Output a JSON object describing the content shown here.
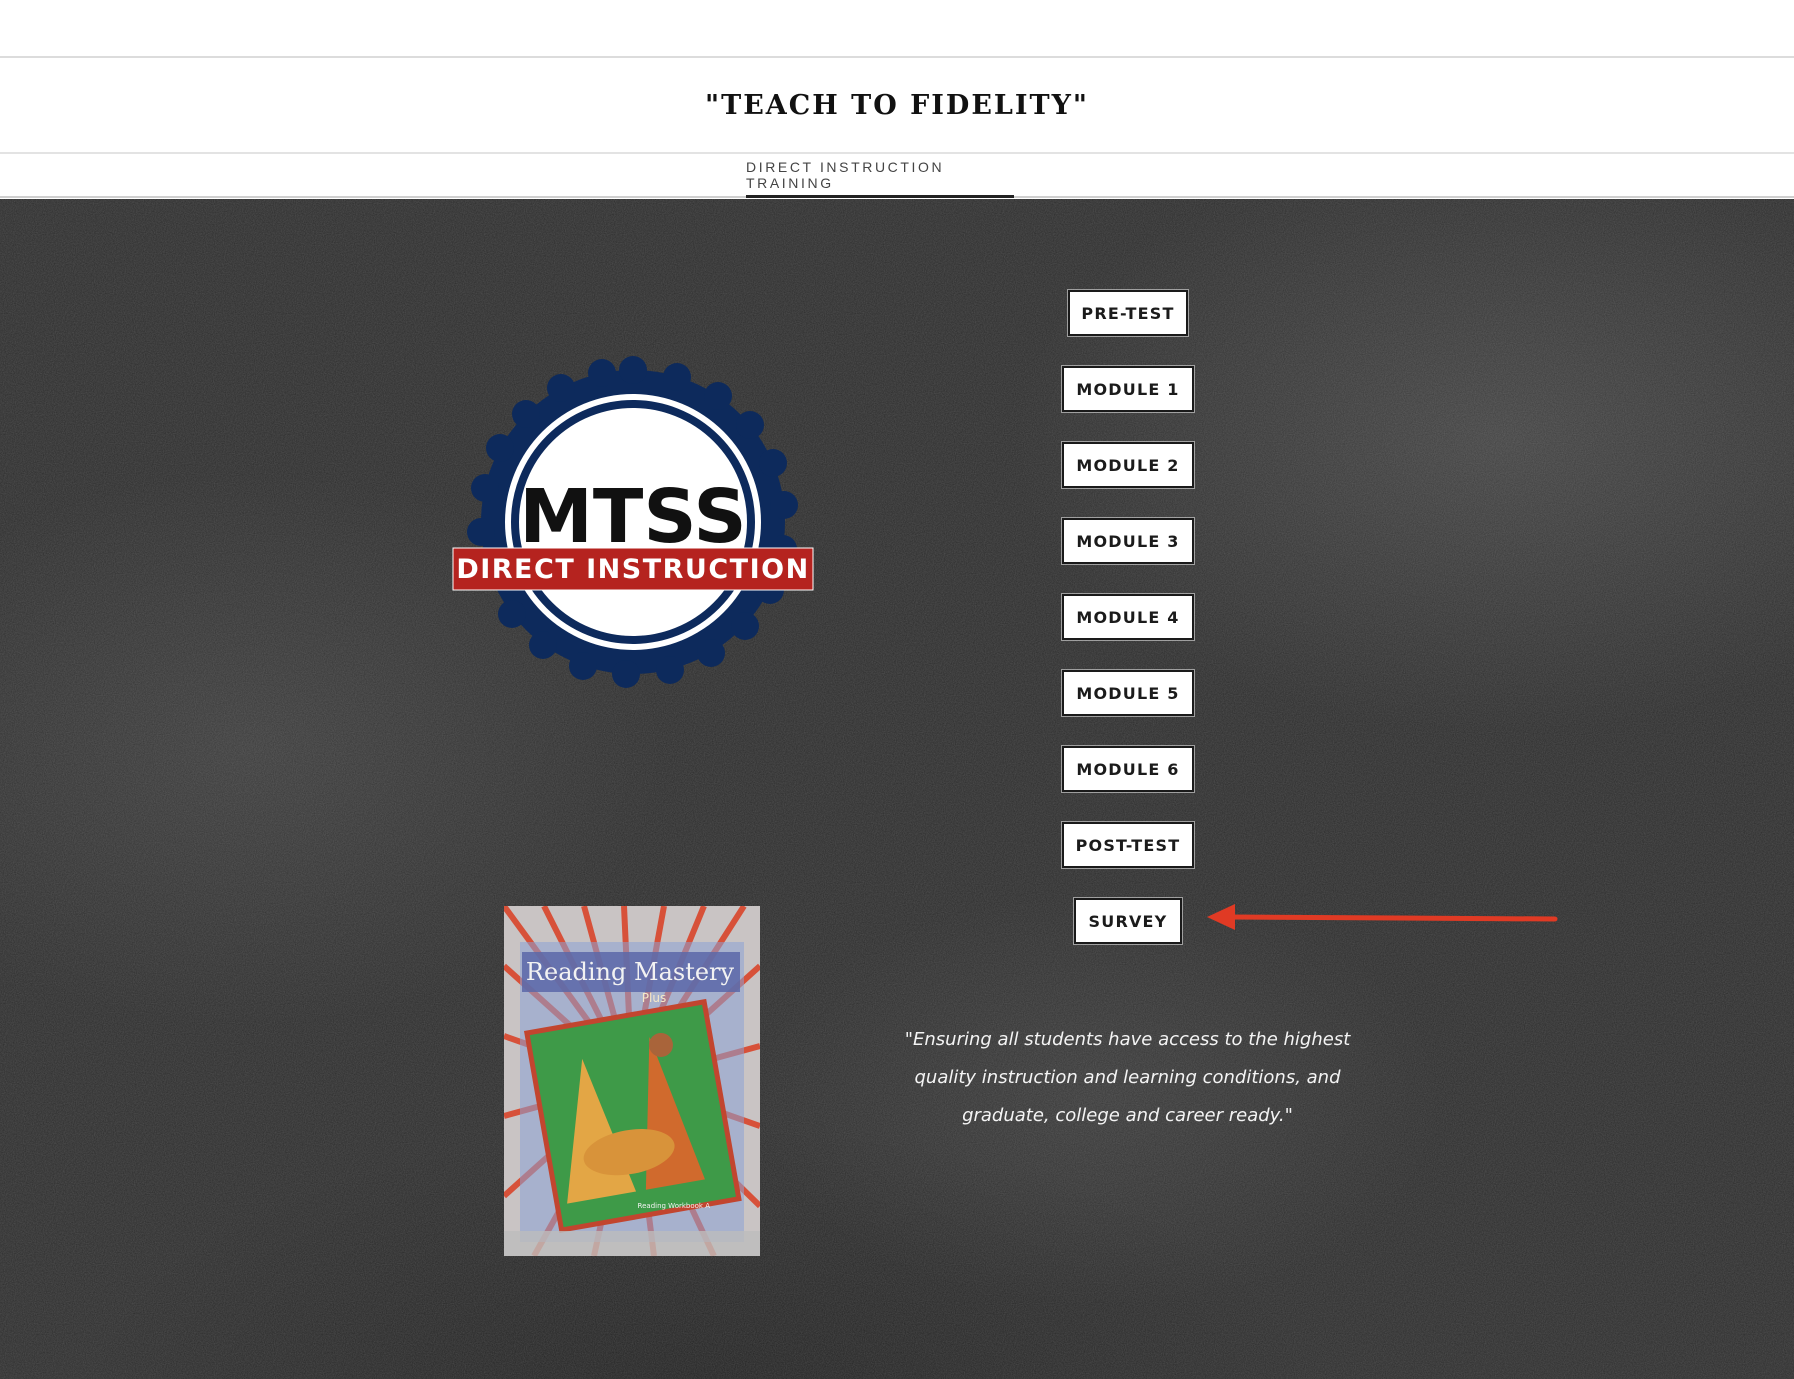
{
  "header": {
    "site_title": "\"TEACH TO FIDELITY\""
  },
  "nav": {
    "items": [
      {
        "label": "DIRECT INSTRUCTION TRAINING",
        "active": true
      }
    ]
  },
  "badge": {
    "title": "MTSS",
    "ribbon": "DIRECT INSTRUCTION"
  },
  "book": {
    "title": "Reading Mastery",
    "subtitle": "Plus",
    "footer": "Reading Workbook A"
  },
  "buttons": [
    {
      "label": "PRE-TEST"
    },
    {
      "label": "MODULE 1"
    },
    {
      "label": "MODULE 2"
    },
    {
      "label": "MODULE 3"
    },
    {
      "label": "MODULE 4"
    },
    {
      "label": "MODULE 5"
    },
    {
      "label": "MODULE 6"
    },
    {
      "label": "POST-TEST"
    },
    {
      "label": "SURVEY"
    }
  ],
  "quote": "\"Ensuring all students have access to the highest quality instruction and learning conditions, and graduate, college and career ready.\"",
  "colors": {
    "background": "#2b2b2b",
    "badge_navy": "#0d2a5c",
    "ribbon_red": "#b5231f",
    "arrow_red": "#e03a24"
  }
}
